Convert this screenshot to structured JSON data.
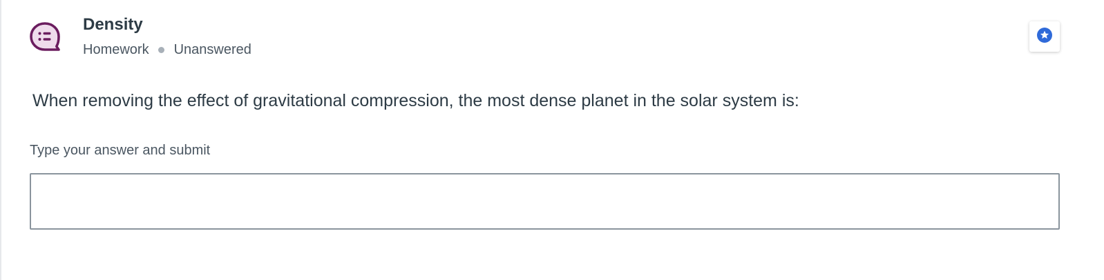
{
  "question": {
    "title": "Density",
    "category": "Homework",
    "status": "Unanswered",
    "prompt": "When removing the effect of gravitational compression, the most dense planet in the solar system is:"
  },
  "answer": {
    "label": "Type your answer and submit",
    "value": "",
    "placeholder": ""
  },
  "icons": {
    "question_icon": "speech-bubble-list-icon",
    "favorite_icon": "star-icon"
  },
  "colors": {
    "icon_purple": "#6b1d5f",
    "icon_bg": "#efdcec",
    "star_blue": "#2f6ad9",
    "text_dark": "#2d3b45",
    "text_muted": "#4a5661",
    "input_border": "#8a949d"
  }
}
